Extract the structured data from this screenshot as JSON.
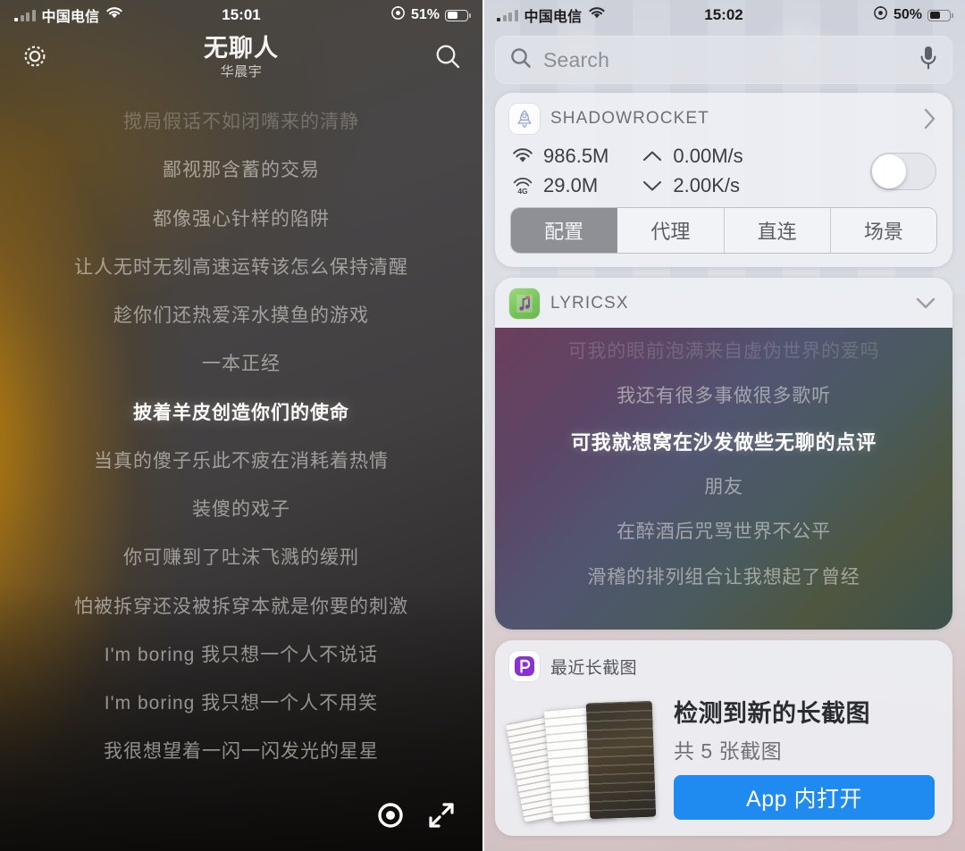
{
  "left": {
    "status_bar": {
      "carrier": "中国电信",
      "time": "15:01",
      "battery_percent": "51%",
      "signal_icon": "cellular-signal-icon",
      "wifi_icon": "wifi-icon",
      "lock_rotation_icon": "rotation-lock-icon",
      "battery_icon": "battery-icon"
    },
    "nav": {
      "settings_icon": "gear-icon",
      "search_icon": "search-icon",
      "title": "无聊人",
      "artist": "华晨宇"
    },
    "lyrics": [
      {
        "text": "搅局假话不如闭嘴来的清静",
        "state": "faded"
      },
      {
        "text": "鄙视那含蓄的交易",
        "state": "normal"
      },
      {
        "text": "都像强心针样的陷阱",
        "state": "normal"
      },
      {
        "text": "让人无时无刻高速运转该怎么保持清醒",
        "state": "normal"
      },
      {
        "text": "趁你们还热爱浑水摸鱼的游戏",
        "state": "normal"
      },
      {
        "text": "一本正经",
        "state": "normal"
      },
      {
        "text": "披着羊皮创造你们的使命",
        "state": "active"
      },
      {
        "text": "当真的傻子乐此不疲在消耗着热情",
        "state": "normal"
      },
      {
        "text": "装傻的戏子",
        "state": "normal"
      },
      {
        "text": "你可赚到了吐沫飞溅的缓刑",
        "state": "normal"
      },
      {
        "text": "怕被拆穿还没被拆穿本就是你要的刺激",
        "state": "normal"
      },
      {
        "text": "I'm boring 我只想一个人不说话",
        "state": "normal"
      },
      {
        "text": "I'm boring 我只想一个人不用笑",
        "state": "normal"
      },
      {
        "text": "我很想望着一闪一闪发光的星星",
        "state": "normal"
      }
    ],
    "controls": {
      "locate_icon": "locate-current-lyric-icon",
      "fullscreen_icon": "expand-fullscreen-icon"
    }
  },
  "right": {
    "status_bar": {
      "carrier": "中国电信",
      "time": "15:02",
      "battery_percent": "50%",
      "signal_icon": "cellular-signal-icon",
      "wifi_icon": "wifi-icon",
      "lock_rotation_icon": "rotation-lock-icon",
      "battery_icon": "battery-icon"
    },
    "search": {
      "placeholder": "Search",
      "search_icon": "search-icon",
      "mic_icon": "microphone-icon"
    },
    "widgets": {
      "shadowrocket": {
        "title": "SHADOWROCKET",
        "app_icon": "rocket-icon",
        "chevron_icon": "chevron-right-icon",
        "stats": {
          "wifi_label": "986.5M",
          "wifi_icon": "wifi-icon",
          "cellular_label": "29.0M",
          "cellular_icon": "4g-icon",
          "upload_label": "0.00M/s",
          "upload_icon": "chevron-up-icon",
          "download_label": "2.00K/s",
          "download_icon": "chevron-down-icon"
        },
        "toggle_state": "off",
        "segments": [
          {
            "label": "配置",
            "selected": true
          },
          {
            "label": "代理",
            "selected": false
          },
          {
            "label": "直连",
            "selected": false
          },
          {
            "label": "场景",
            "selected": false
          }
        ]
      },
      "lyricsx": {
        "title": "LYRICSX",
        "app_icon": "music-note-icon",
        "chevron_icon": "chevron-down-icon",
        "lines": [
          {
            "text": "可我的眼前泡满来自虚伪世界的爱吗",
            "state": "clipped"
          },
          {
            "text": "我还有很多事做很多歌听",
            "state": "normal"
          },
          {
            "text": "可我就想窝在沙发做些无聊的点评",
            "state": "active"
          },
          {
            "text": "朋友",
            "state": "normal"
          },
          {
            "text": "在醉酒后咒骂世界不公平",
            "state": "normal"
          },
          {
            "text": "滑稽的排列组合让我想起了曾经",
            "state": "normal"
          }
        ]
      },
      "picsew": {
        "title": "最近长截图",
        "app_icon": "picsew-p-icon",
        "headline": "检测到新的长截图",
        "subtitle": "共 5 张截图",
        "button_label": "App 内打开",
        "button_color": "#1f8af0"
      }
    }
  },
  "colors": {
    "left_glow": "#c48408",
    "left_bg": "#3f3d3e",
    "lyricsx_gradient_start": "#6b3f5c",
    "lyricsx_gradient_end": "#3d504c",
    "widget_bg": "#eef0f5",
    "accent_blue": "#1f8af0",
    "segment_active": "#8e9096"
  }
}
